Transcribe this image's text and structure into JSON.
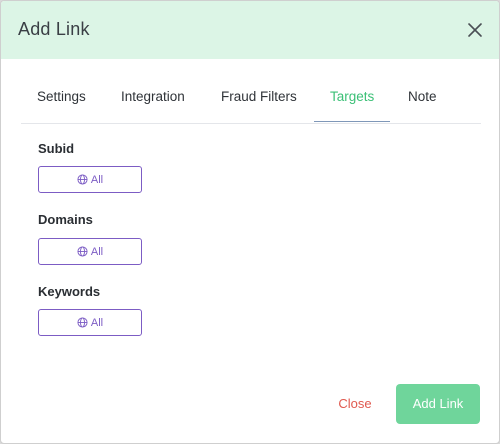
{
  "modal": {
    "title": "Add Link"
  },
  "tabs": [
    {
      "label": "Settings",
      "active": false
    },
    {
      "label": "Integration",
      "active": false
    },
    {
      "label": "Fraud Filters",
      "active": false
    },
    {
      "label": "Targets",
      "active": true
    },
    {
      "label": "Note",
      "active": false
    }
  ],
  "sections": {
    "subid": {
      "label": "Subid",
      "button_label": "All",
      "icon": "globe-icon"
    },
    "domains": {
      "label": "Domains",
      "button_label": "All",
      "icon": "globe-icon"
    },
    "keywords": {
      "label": "Keywords",
      "button_label": "All",
      "icon": "globe-icon"
    }
  },
  "footer": {
    "close_label": "Close",
    "add_label": "Add Link"
  },
  "colors": {
    "header_bg": "#dcf5e6",
    "active_tab": "#3cc077",
    "target_button": "#7c5cc4",
    "close_text": "#e0594f",
    "add_button_bg": "#6fd59b"
  }
}
